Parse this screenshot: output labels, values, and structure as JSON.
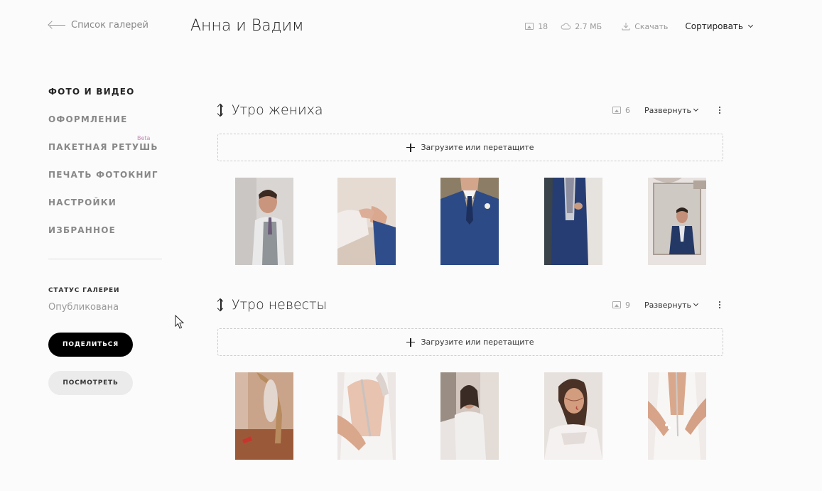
{
  "header": {
    "back_label": "Список галерей",
    "title": "Анна и Вадим",
    "photo_count": "18",
    "storage": "2.7 МБ",
    "download_label": "Скачать",
    "sort_label": "Сортировать"
  },
  "sidebar": {
    "items": [
      {
        "label": "ФОТО И ВИДЕО"
      },
      {
        "label": "ОФОРМЛЕНИЕ"
      },
      {
        "label": "ПАКЕТНАЯ РЕТУШЬ",
        "badge": "Beta"
      },
      {
        "label": "ПЕЧАТЬ ФОТОКНИГ"
      },
      {
        "label": "НАСТРОЙКИ"
      },
      {
        "label": "ИЗБРАННОЕ"
      }
    ],
    "status_label": "СТАТУС ГАЛЕРЕИ",
    "status_value": "Опубликована",
    "share_label": "ПОДЕЛИТЬСЯ",
    "view_label": "ПОСМОТРЕТЬ"
  },
  "sections": [
    {
      "title": "Утро жениха",
      "count": "6",
      "expand_label": "Развернуть",
      "upload_label": "Загрузите или перетащите"
    },
    {
      "title": "Утро невесты",
      "count": "9",
      "expand_label": "Развернуть",
      "upload_label": "Загрузите или перетащите"
    }
  ],
  "colors": {
    "accent": "#000000",
    "beta": "#c48bb6",
    "muted": "#888888"
  }
}
